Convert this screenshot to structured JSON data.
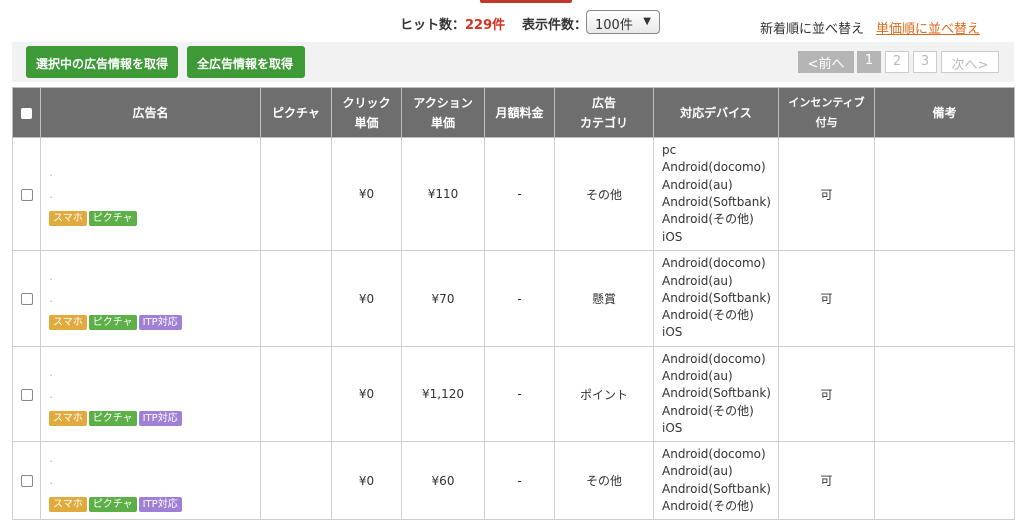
{
  "header": {
    "hit_label": "ヒット数：",
    "hit_count": "229件",
    "perpage_label": "表示件数：",
    "perpage_value": "100件",
    "sort_new": "新着順に並べ替え",
    "sort_price": "単価順に並べ替え"
  },
  "toolbar": {
    "get_selected": "選択中の広告情報を取得",
    "get_all": "全広告情報を取得"
  },
  "pager": {
    "prev": "<前へ",
    "pages": [
      "1",
      "2",
      "3"
    ],
    "next": "次へ>"
  },
  "table": {
    "columns": [
      "広告名",
      "ピクチャ",
      "クリック\n単価",
      "アクション\n単価",
      "月額料金",
      "広告\nカテゴリ",
      "対応デバイス",
      "インセンティブ\n付与",
      "備考"
    ],
    "rows": [
      {
        "name_dots": "．\n．",
        "tags": [
          "スマホ",
          "ピクチャ"
        ],
        "click": "¥0",
        "action": "¥110",
        "monthly": "-",
        "category": "その他",
        "devices": [
          "pc",
          "Android(docomo)",
          "Android(au)",
          "Android(Softbank)",
          "Android(その他)",
          "iOS"
        ],
        "incentive": "可",
        "note": ""
      },
      {
        "name_dots": "．\n．",
        "tags": [
          "スマホ",
          "ピクチャ",
          "ITP対応"
        ],
        "click": "¥0",
        "action": "¥70",
        "monthly": "-",
        "category": "懸賞",
        "devices": [
          "Android(docomo)",
          "Android(au)",
          "Android(Softbank)",
          "Android(その他)",
          "iOS"
        ],
        "incentive": "可",
        "note": ""
      },
      {
        "name_dots": "．\n．",
        "tags": [
          "スマホ",
          "ピクチャ",
          "ITP対応"
        ],
        "click": "¥0",
        "action": "¥1,120",
        "monthly": "-",
        "category": "ポイント",
        "devices": [
          "Android(docomo)",
          "Android(au)",
          "Android(Softbank)",
          "Android(その他)",
          "iOS"
        ],
        "incentive": "可",
        "note": ""
      },
      {
        "name_dots": "．\n．",
        "tags": [
          "スマホ",
          "ピクチャ",
          "ITP対応"
        ],
        "click": "¥0",
        "action": "¥60",
        "monthly": "-",
        "category": "その他",
        "devices": [
          "Android(docomo)",
          "Android(au)",
          "Android(Softbank)",
          "Android(その他)"
        ],
        "incentive": "可",
        "note": ""
      }
    ]
  },
  "colors": {
    "accent_red": "#d7301f",
    "button_green": "#3d9a37",
    "header_gray": "#6e6e6e",
    "tag_smartphone": "#e0ab3c",
    "tag_picture": "#5cb047",
    "tag_itp": "#a07fd6",
    "sort_link": "#e06a1b"
  }
}
